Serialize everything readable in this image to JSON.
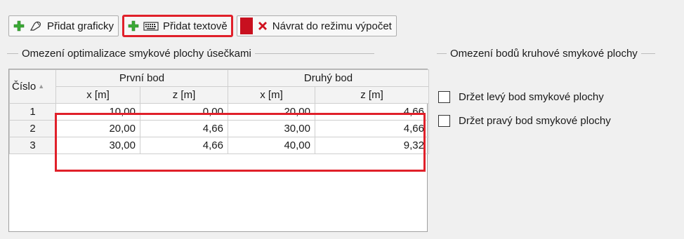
{
  "toolbar": {
    "add_graphic_label": "Přidat graficky",
    "add_text_label": "Přidat textově",
    "return_label": "Návrat do režimu výpočet"
  },
  "left_group": {
    "title": "Omezení optimalizace smykové plochy úsečkami"
  },
  "right_group": {
    "title": "Omezení bodů kruhové smykové plochy",
    "options": [
      {
        "label": "Držet levý bod smykové plochy",
        "checked": false
      },
      {
        "label": "Držet pravý bod smykové plochy",
        "checked": false
      }
    ]
  },
  "table": {
    "col_number": "Číslo",
    "group_first": "První bod",
    "group_second": "Druhý bod",
    "x_unit": "x [m]",
    "z_unit": "z [m]",
    "rows": [
      {
        "n": "1",
        "x1": "10,00",
        "z1": "0,00",
        "x2": "20,00",
        "z2": "4,66"
      },
      {
        "n": "2",
        "x1": "20,00",
        "z1": "4,66",
        "x2": "30,00",
        "z2": "4,66"
      },
      {
        "n": "3",
        "x1": "30,00",
        "z1": "4,66",
        "x2": "40,00",
        "z2": "9,32"
      }
    ]
  },
  "colors": {
    "add_icon": "#3aaa35",
    "highlight": "#e0202a",
    "close_icon": "#d0121f"
  }
}
